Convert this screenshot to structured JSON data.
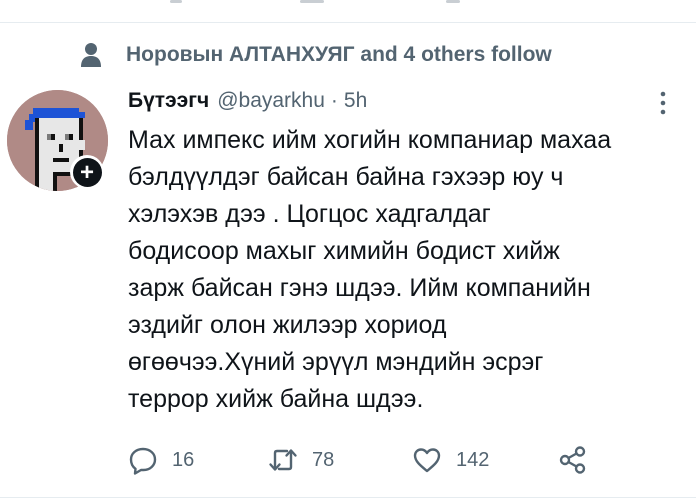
{
  "social_context": {
    "text": "Норовын АЛТАНХУЯГ and 4 others follow",
    "icon": "person-icon"
  },
  "tweet": {
    "author_name": "Бүтээгч",
    "handle": "@bayarkhu",
    "separator": "·",
    "time": "5h",
    "body_lines": [
      "Мах импекс ийм хогийн компаниар махаа",
      "бэлдүүлдэг байсан байна гэхээр юу ч",
      "хэлэхэв дээ . Цогцос  хадгалдаг",
      "бодисоор махыг химийн бодист хийж",
      "зарж байсан гэнэ шдээ. Ийм компанийн",
      "эздийг олон жилээр хориод",
      "өгөөчээ.Хүний эрүүл мэндийн эсрэг",
      "террор хийж байна шдээ."
    ],
    "follow_badge": "+"
  },
  "actions": {
    "reply_count": "16",
    "retweet_count": "78",
    "like_count": "142",
    "icons": [
      "reply-icon",
      "retweet-icon",
      "like-icon",
      "share-icon"
    ]
  },
  "colors": {
    "text_primary": "#0f1419",
    "text_secondary": "#536471",
    "divider": "#e6ecf0",
    "avatar_bg": "#b08a86",
    "avatar_hat": "#1d53d6"
  }
}
